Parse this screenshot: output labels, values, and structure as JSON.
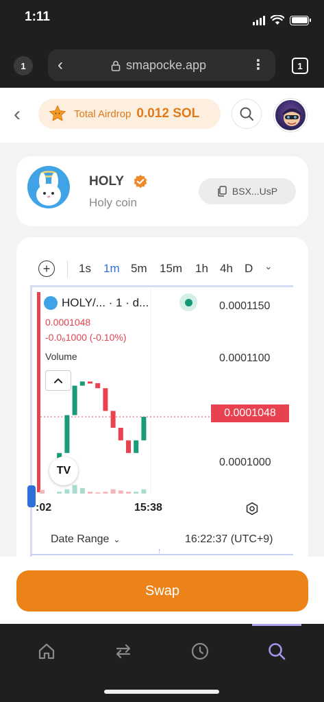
{
  "status_bar": {
    "time": "1:11"
  },
  "browser": {
    "tab_number": "1",
    "url": "smapocke.app",
    "tabs_count": "1"
  },
  "header": {
    "airdrop_label": "Total Airdrop",
    "airdrop_value": "0.012 SOL"
  },
  "token": {
    "name": "HOLY",
    "subtitle": "Holy coin",
    "address_short": "BSX...UsP"
  },
  "timeframes": {
    "plus": "+",
    "items": [
      "1s",
      "1m",
      "5m",
      "15m",
      "1h",
      "4h",
      "D"
    ],
    "active": "1m"
  },
  "chart": {
    "legend": "HOLY/... · 1 · d...",
    "price": "0.0001048",
    "change": "-0.0₆1000 (-0.10%)",
    "volume_label": "Volume",
    "y_labels": [
      "0.0001150",
      "0.0001100",
      "0.0001000"
    ],
    "current_price": "0.0001048",
    "x_labels": [
      ":02",
      "15:38"
    ],
    "logo_text": "TV",
    "date_range": "Date Range",
    "clock": "16:22:37 (UTC+9)"
  },
  "chart_data": {
    "type": "candlestick",
    "ylim": [
      9.6e-05,
      0.000118
    ],
    "y_ticks": [
      0.0001,
      0.00011,
      0.000115
    ],
    "current_price": 0.0001048,
    "candles": [
      {
        "o": 0.000109,
        "c": 9.6e-05,
        "up": false
      },
      {
        "o": 9.8e-05,
        "c": 0.0001005,
        "up": true
      },
      {
        "o": 0.0001005,
        "c": 0.000105,
        "up": true
      },
      {
        "o": 0.000105,
        "c": 0.0001085,
        "up": true
      },
      {
        "o": 0.0001085,
        "c": 0.000109,
        "up": true
      },
      {
        "o": 0.000109,
        "c": 0.0001088,
        "up": false
      },
      {
        "o": 0.0001088,
        "c": 0.0001082,
        "up": false
      },
      {
        "o": 0.0001082,
        "c": 0.0001055,
        "up": false
      },
      {
        "o": 0.0001055,
        "c": 0.0001035,
        "up": false
      },
      {
        "o": 0.0001035,
        "c": 0.000102,
        "up": false
      },
      {
        "o": 0.000102,
        "c": 0.0001005,
        "up": false
      },
      {
        "o": 0.0001005,
        "c": 0.000102,
        "up": true
      },
      {
        "o": 0.000102,
        "c": 0.0001048,
        "up": true
      }
    ],
    "volumes": [
      0.3,
      0.15,
      0.35,
      0.7,
      0.45,
      0.15,
      0.1,
      0.15,
      0.35,
      0.25,
      0.15,
      0.15,
      0.35
    ]
  },
  "swap": {
    "label": "Swap"
  },
  "nav": {
    "items": [
      "home-icon",
      "swap-arrows-icon",
      "history-icon",
      "search-icon"
    ],
    "active_index": 3
  },
  "colors": {
    "accent": "#ec8319",
    "up": "#1a9a7a",
    "down": "#e8414f",
    "link": "#2f6fd8"
  }
}
